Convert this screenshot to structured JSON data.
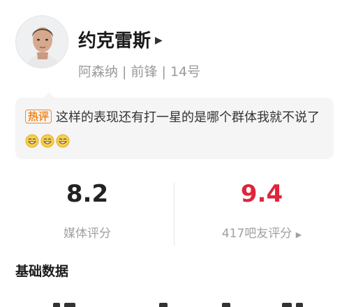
{
  "player": {
    "name": "约克雷斯",
    "meta": "阿森纳 | 前锋 | 14号"
  },
  "hot_comment": {
    "tag": "热评",
    "text": "这样的表现还有打一星的是哪个群体我就不说了",
    "emoji_count": 3
  },
  "ratings": {
    "media": {
      "score": "8.2",
      "label": "媒体评分"
    },
    "fans": {
      "score": "9.4",
      "label": "417吧友评分"
    }
  },
  "sections": {
    "basic_data": "基础数据"
  },
  "colors": {
    "fan_score": "#e0243b",
    "hot_tag": "#f08a24",
    "muted_text": "#9a9a9a",
    "comment_bg": "#f5f5f5"
  },
  "icons": {
    "name_arrow": "caret-right-icon",
    "fan_arrow": "caret-right-icon",
    "emoji": "grinning-face-icon"
  }
}
